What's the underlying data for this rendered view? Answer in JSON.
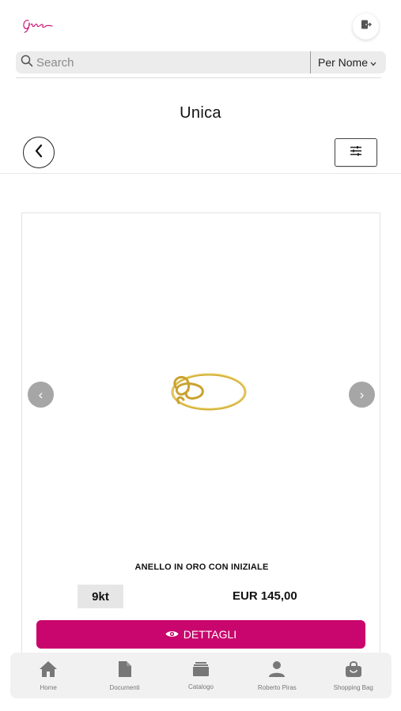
{
  "header": {
    "logo_text": "Gioia"
  },
  "search": {
    "placeholder": "Search",
    "value": "",
    "sort_label": "Per Nome"
  },
  "page": {
    "title": "Unica"
  },
  "product": {
    "name": "ANELLO IN ORO CON INIZIALE",
    "karat": "9kt",
    "price": "EUR 145,00",
    "details_label": "DETTAGLI",
    "carousel_prev": "‹",
    "carousel_next": "›"
  },
  "nav": {
    "items": [
      {
        "label": "Home",
        "icon": "home-icon"
      },
      {
        "label": "Documenti",
        "icon": "document-icon"
      },
      {
        "label": "Catalogo",
        "icon": "catalog-icon"
      },
      {
        "label": "Roberto Piras",
        "icon": "user-icon"
      },
      {
        "label": "Shopping Bag",
        "icon": "shopping-bag-icon"
      }
    ]
  },
  "colors": {
    "accent": "#c9066d",
    "logo": "#c9066d",
    "ring_gold": "#d4b23a"
  }
}
